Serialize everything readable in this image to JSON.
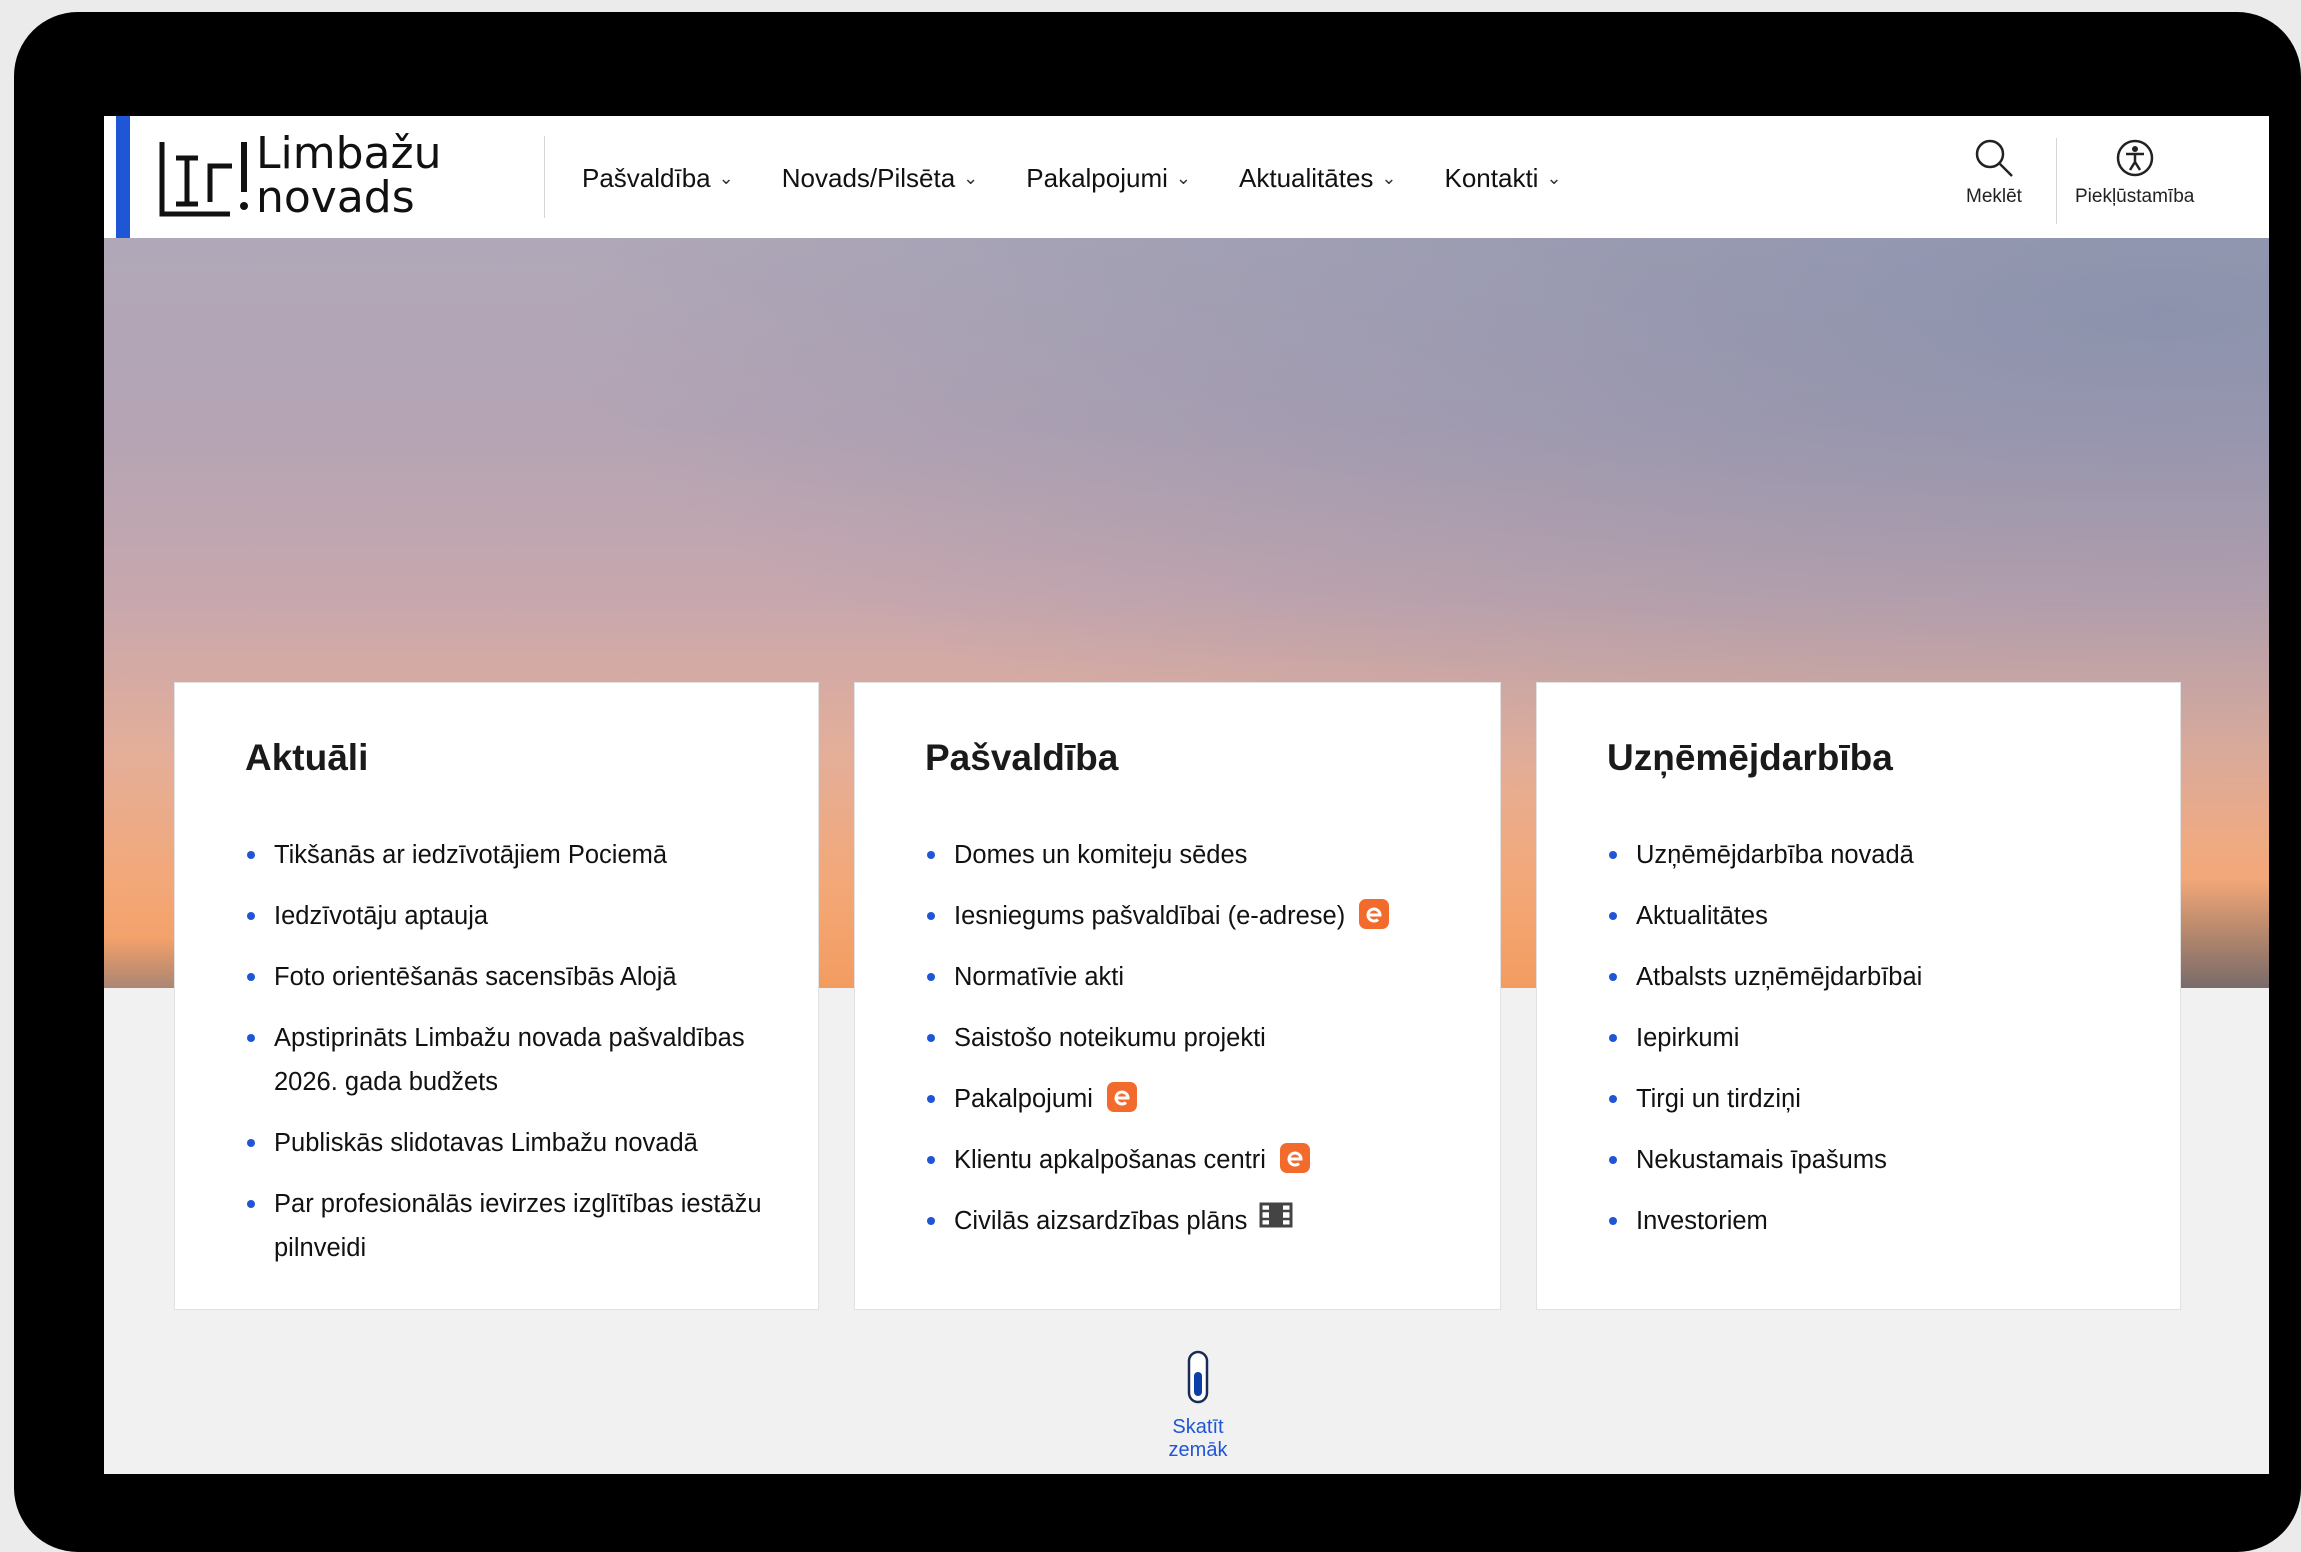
{
  "header": {
    "logo": {
      "line1": "Limbažu",
      "line2": "novads"
    },
    "nav": [
      {
        "label": "Pašvaldība"
      },
      {
        "label": "Novads/Pilsēta"
      },
      {
        "label": "Pakalpojumi"
      },
      {
        "label": "Aktualitātes"
      },
      {
        "label": "Kontakti"
      }
    ],
    "search_label": "Meklēt",
    "accessibility_label": "Piekļūstamība"
  },
  "cards": [
    {
      "title": "Aktuāli",
      "items": [
        "Tikšanās ar iedzīvotājiem Pociemā",
        "Iedzīvotāju aptauja",
        "Foto orientēšanās sacensībās Alojā",
        "Apstiprināts Limbažu novada pašvaldības 2026. gada budžets",
        "Publiskās slidotavas Limbažu novadā",
        "Par profesionālās ievirzes izglītības iestāžu pilnveidi"
      ]
    },
    {
      "title": "Pašvaldība",
      "items": [
        "Domes un komiteju sēdes",
        "Iesniegums pašvaldībai (e-adrese)",
        "Normatīvie akti",
        "Saistošo noteikumu projekti",
        "Pakalpojumi",
        "Klientu apkalpošanas centri",
        "Civilās aizsardzības plāns"
      ]
    },
    {
      "title": "Uzņēmējdarbība",
      "items": [
        "Uzņēmējdarbība novadā",
        "Aktualitātes",
        "Atbalsts uzņēmējdarbībai",
        "Iepirkumi",
        "Tirgi un tirdziņi",
        "Nekustamais īpašums",
        "Investoriem"
      ]
    }
  ],
  "scroll_label": "Skatīt zemāk",
  "colors": {
    "accent": "#1f56d6",
    "e_badge": "#f26b2c"
  },
  "icons": [
    "search-icon",
    "accessibility-icon",
    "e-service-icon",
    "film-icon",
    "mouse-scroll-icon"
  ]
}
